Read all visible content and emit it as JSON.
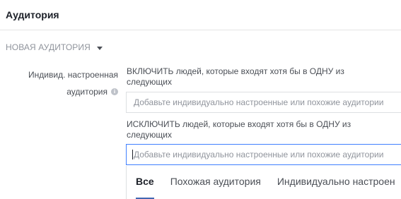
{
  "header": {
    "title": "Аудитория"
  },
  "new_audience": {
    "label": "НОВАЯ АУДИТОРИЯ",
    "icon": "caret-down-icon"
  },
  "custom_audience": {
    "label_line1": "Индивид. настроенная",
    "label_line2": "аудитория",
    "info_icon": "info-icon",
    "include": {
      "label": "ВКЛЮЧИТЬ людей, которые входят хотя бы в ОДНУ из следующих",
      "placeholder": "Добавьте индивидуально настроенные или похожие аудитории"
    },
    "exclude": {
      "label": "ИСКЛЮЧИТЬ людей, которые входят хотя бы в ОДНУ из следующих",
      "placeholder": "Добавьте индивидуально настроенные или похожие аудитории"
    }
  },
  "dropdown": {
    "tabs": [
      {
        "label": "Все",
        "active": true
      },
      {
        "label": "Похожая аудитория",
        "active": false
      },
      {
        "label": "Индивидуально настроен",
        "active": false
      }
    ]
  },
  "colors": {
    "accent": "#4267b2",
    "focus_border": "#4080ff",
    "muted_text": "#90949c"
  }
}
